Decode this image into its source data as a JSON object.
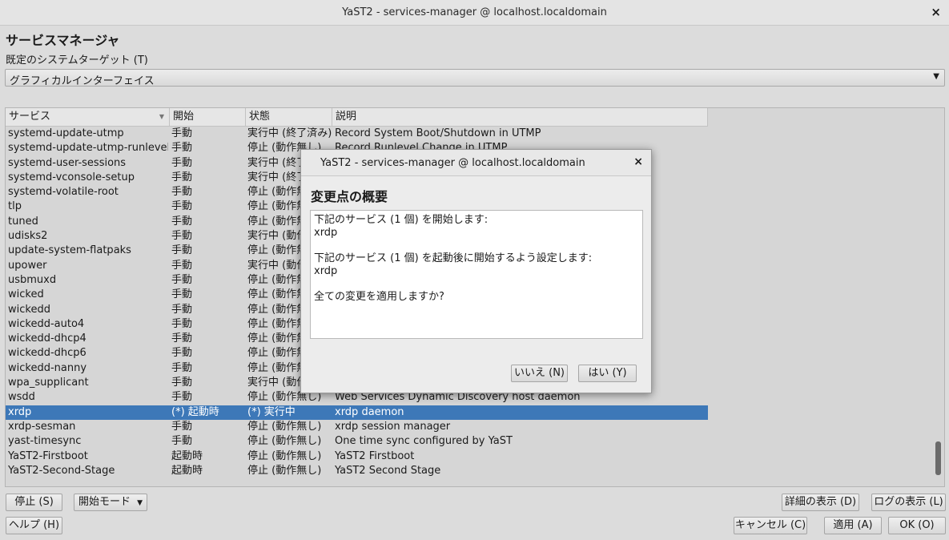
{
  "window": {
    "title": "YaST2 - services-manager @ localhost.localdomain",
    "close": "×"
  },
  "page": {
    "heading": "サービスマネージャ",
    "target_label": "既定のシステムターゲット (T)",
    "target_value": "グラフィカルインターフェイス"
  },
  "table": {
    "columns": [
      "サービス",
      "開始",
      "状態",
      "説明"
    ],
    "rows": [
      [
        "systemd-update-utmp",
        "手動",
        "実行中 (終了済み)",
        "Record System Boot/Shutdown in UTMP"
      ],
      [
        "systemd-update-utmp-runlevel",
        "手動",
        "停止 (動作無し)",
        "Record Runlevel Change in UTMP"
      ],
      [
        "systemd-user-sessions",
        "手動",
        "実行中 (終了済み)",
        ""
      ],
      [
        "systemd-vconsole-setup",
        "手動",
        "実行中 (終了済み)",
        ""
      ],
      [
        "systemd-volatile-root",
        "手動",
        "停止 (動作無し)",
        ""
      ],
      [
        "tlp",
        "手動",
        "停止 (動作無し)",
        ""
      ],
      [
        "tuned",
        "手動",
        "停止 (動作無し)",
        ""
      ],
      [
        "udisks2",
        "手動",
        "実行中 (動作中)",
        ""
      ],
      [
        "update-system-flatpaks",
        "手動",
        "停止 (動作無し)",
        ""
      ],
      [
        "upower",
        "手動",
        "実行中 (動作中)",
        ""
      ],
      [
        "usbmuxd",
        "手動",
        "停止 (動作無し)",
        ""
      ],
      [
        "wicked",
        "手動",
        "停止 (動作無し)",
        ""
      ],
      [
        "wickedd",
        "手動",
        "停止 (動作無し)",
        ""
      ],
      [
        "wickedd-auto4",
        "手動",
        "停止 (動作無し)",
        ""
      ],
      [
        "wickedd-dhcp4",
        "手動",
        "停止 (動作無し)",
        ""
      ],
      [
        "wickedd-dhcp6",
        "手動",
        "停止 (動作無し)",
        ""
      ],
      [
        "wickedd-nanny",
        "手動",
        "停止 (動作無し)",
        ""
      ],
      [
        "wpa_supplicant",
        "手動",
        "実行中 (動作中)",
        ""
      ],
      [
        "wsdd",
        "手動",
        "停止 (動作無し)",
        "Web Services Dynamic Discovery host daemon"
      ],
      [
        "xrdp",
        "(*) 起動時",
        "(*) 実行中",
        "xrdp daemon"
      ],
      [
        "xrdp-sesman",
        "手動",
        "停止 (動作無し)",
        "xrdp session manager"
      ],
      [
        "yast-timesync",
        "手動",
        "停止 (動作無し)",
        "One time sync configured by YaST"
      ],
      [
        "YaST2-Firstboot",
        "起動時",
        "停止 (動作無し)",
        "YaST2 Firstboot"
      ],
      [
        "YaST2-Second-Stage",
        "起動時",
        "停止 (動作無し)",
        "YaST2 Second Stage"
      ]
    ],
    "selected_index": 19
  },
  "buttons": {
    "stop": "停止 (S)",
    "start_mode": "開始モード",
    "details": "詳細の表示 (D)",
    "logs": "ログの表示 (L)",
    "help": "ヘルプ (H)",
    "cancel": "キャンセル (C)",
    "apply": "適用 (A)",
    "ok": "OK (O)"
  },
  "dialog": {
    "title": "YaST2 - services-manager @ localhost.localdomain",
    "close": "×",
    "heading": "変更点の概要",
    "line1": "下記のサービス (1 個) を開始します:",
    "line2": "xrdp",
    "line3": "下記のサービス (1 個) を起動後に開始するよう設定します:",
    "line4": "xrdp",
    "line5": "全ての変更を適用しますか?",
    "no": "いいえ (N)",
    "yes": "はい (Y)"
  },
  "colors": {
    "selection": "#3d78b8"
  },
  "icons": {
    "dropdown": "chevron-down-icon",
    "close": "close-icon",
    "sort": "sort-arrow-icon"
  }
}
